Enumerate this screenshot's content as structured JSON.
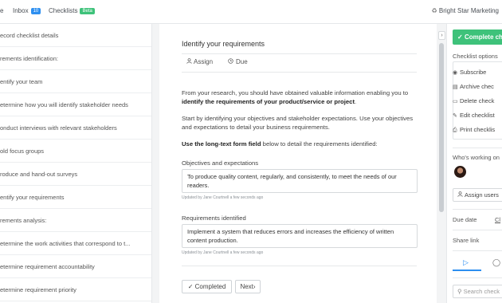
{
  "nav": {
    "items": [
      {
        "label": "e"
      },
      {
        "label": "Inbox",
        "badge": "10"
      },
      {
        "label": "Checklists",
        "badge": "Beta"
      }
    ],
    "org_icon": "team-icon",
    "org_name": "Bright Star Marketing"
  },
  "sidebar": {
    "tasks": [
      {
        "label": "ecord checklist details",
        "state": "done"
      },
      {
        "label": "rements identification:",
        "state": "heading"
      },
      {
        "label": "entify your team",
        "state": "done"
      },
      {
        "label": "etermine how you will identify stakeholder needs",
        "state": "done"
      },
      {
        "label": "onduct interviews with relevant stakeholders",
        "state": "done"
      },
      {
        "label": "old focus groups",
        "state": "done"
      },
      {
        "label": "roduce and hand-out surveys",
        "state": "done"
      },
      {
        "label": "entify your requirements",
        "state": "active"
      },
      {
        "label": "rements analysis:",
        "state": "heading"
      },
      {
        "label": "etermine the work activities that correspond to t...",
        "state": "todo"
      },
      {
        "label": "etermine requirement accountability",
        "state": "todo"
      },
      {
        "label": "etermine requirement priority",
        "state": "todo"
      }
    ]
  },
  "main": {
    "title": "Identify your requirements",
    "assign_label": "Assign",
    "due_label": "Due",
    "para1_text": "From your research, you should have obtained valuable information enabling you to ",
    "para1_bold": "identify the requirements of your product/service or project",
    "para1_end": ".",
    "para2": "Start by identifying your objectives and stakeholder expectations. Use your objectives and expectations to detail your business requirements.",
    "para3_bold": "Use the long-text form field",
    "para3_rest": " below to detail the requirements identified:",
    "fields": [
      {
        "label": "Objectives and expectations",
        "value": "To produce quality content, regularly, and consistently, to meet the needs of our readers.",
        "updated": "Updated by Jane Courtnell a few seconds ago"
      },
      {
        "label": "Requirements identified",
        "value": "Implement a system that reduces errors and increases the efficiency of written content production.",
        "updated": "Updated by Jane Courtnell a few seconds ago"
      }
    ],
    "completed_label": "Completed",
    "next_label": "Next"
  },
  "right": {
    "complete_label": "Complete ch",
    "options_title": "Checklist options",
    "options": [
      {
        "icon": "eye-icon",
        "label": "Subscribe"
      },
      {
        "icon": "archive-icon",
        "label": "Archive chec"
      },
      {
        "icon": "trash-icon",
        "label": "Delete check"
      },
      {
        "icon": "pencil-icon",
        "label": "Edit checklist"
      },
      {
        "icon": "printer-icon",
        "label": "Print checklis"
      }
    ],
    "working_title": "Who's working on",
    "assign_users_label": "Assign users",
    "due_date_label": "Due date",
    "due_date_action": "Cl",
    "share_link_label": "Share link",
    "search_placeholder": "Search check"
  },
  "colors": {
    "accent": "#2d8ff0",
    "success": "#3ec27a"
  }
}
